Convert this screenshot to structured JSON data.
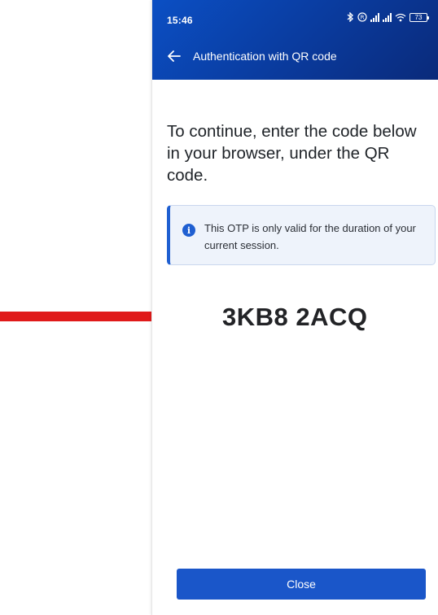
{
  "status_bar": {
    "time": "15:46",
    "battery": "73"
  },
  "appbar": {
    "title": "Authentication with QR code"
  },
  "main": {
    "headline": "To continue, enter the code below in your browser, under the QR code.",
    "info_text": "This OTP is only valid for the duration of your current session.",
    "otp_code": "3KB8 2ACQ"
  },
  "footer": {
    "close_label": "Close"
  },
  "colors": {
    "brand": "#0a3a9c",
    "button": "#1a56c9",
    "annotation_arrow": "#e01a1a"
  }
}
